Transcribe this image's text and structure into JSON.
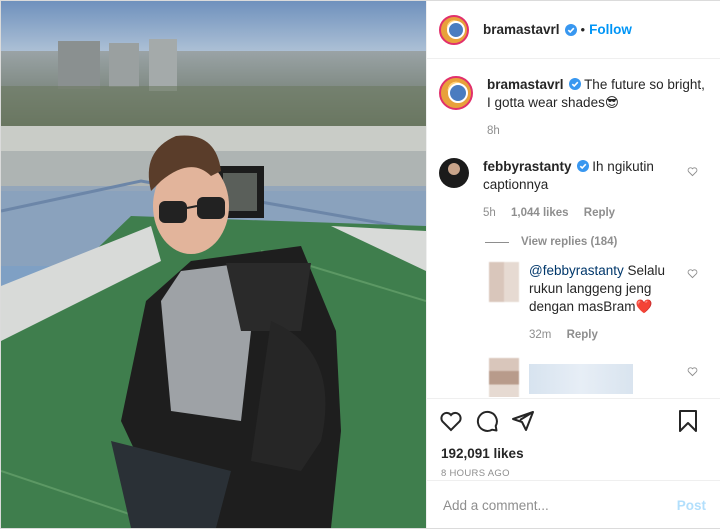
{
  "post": {
    "username": "bramastavrl",
    "follow_label": "Follow",
    "dot": "•",
    "caption": "The future so bright, I gotta wear shades😎",
    "caption_time": "8h"
  },
  "comments": [
    {
      "username": "febbyrastanty",
      "text": "Ih ngikutin captionnya",
      "time": "5h",
      "likes": "1,044 likes",
      "reply_label": "Reply"
    }
  ],
  "view_replies": "View replies (184)",
  "replies": [
    {
      "mention": "@febbyrastanty",
      "text": "Selalu rukun langgeng jeng dengan masBram",
      "emoji": "❤️",
      "time": "32m",
      "reply_label": "Reply"
    }
  ],
  "like_count": "192,091 likes",
  "timestamp": "8 HOURS AGO",
  "add_comment_placeholder": "Add a comment...",
  "post_label": "Post",
  "icons": [
    "verified-badge-icon",
    "heart-icon",
    "comment-icon",
    "share-icon",
    "bookmark-icon"
  ],
  "colors": {
    "accent": "#0095f6",
    "mention": "#00376b",
    "post_disabled": "#b2dffc"
  }
}
